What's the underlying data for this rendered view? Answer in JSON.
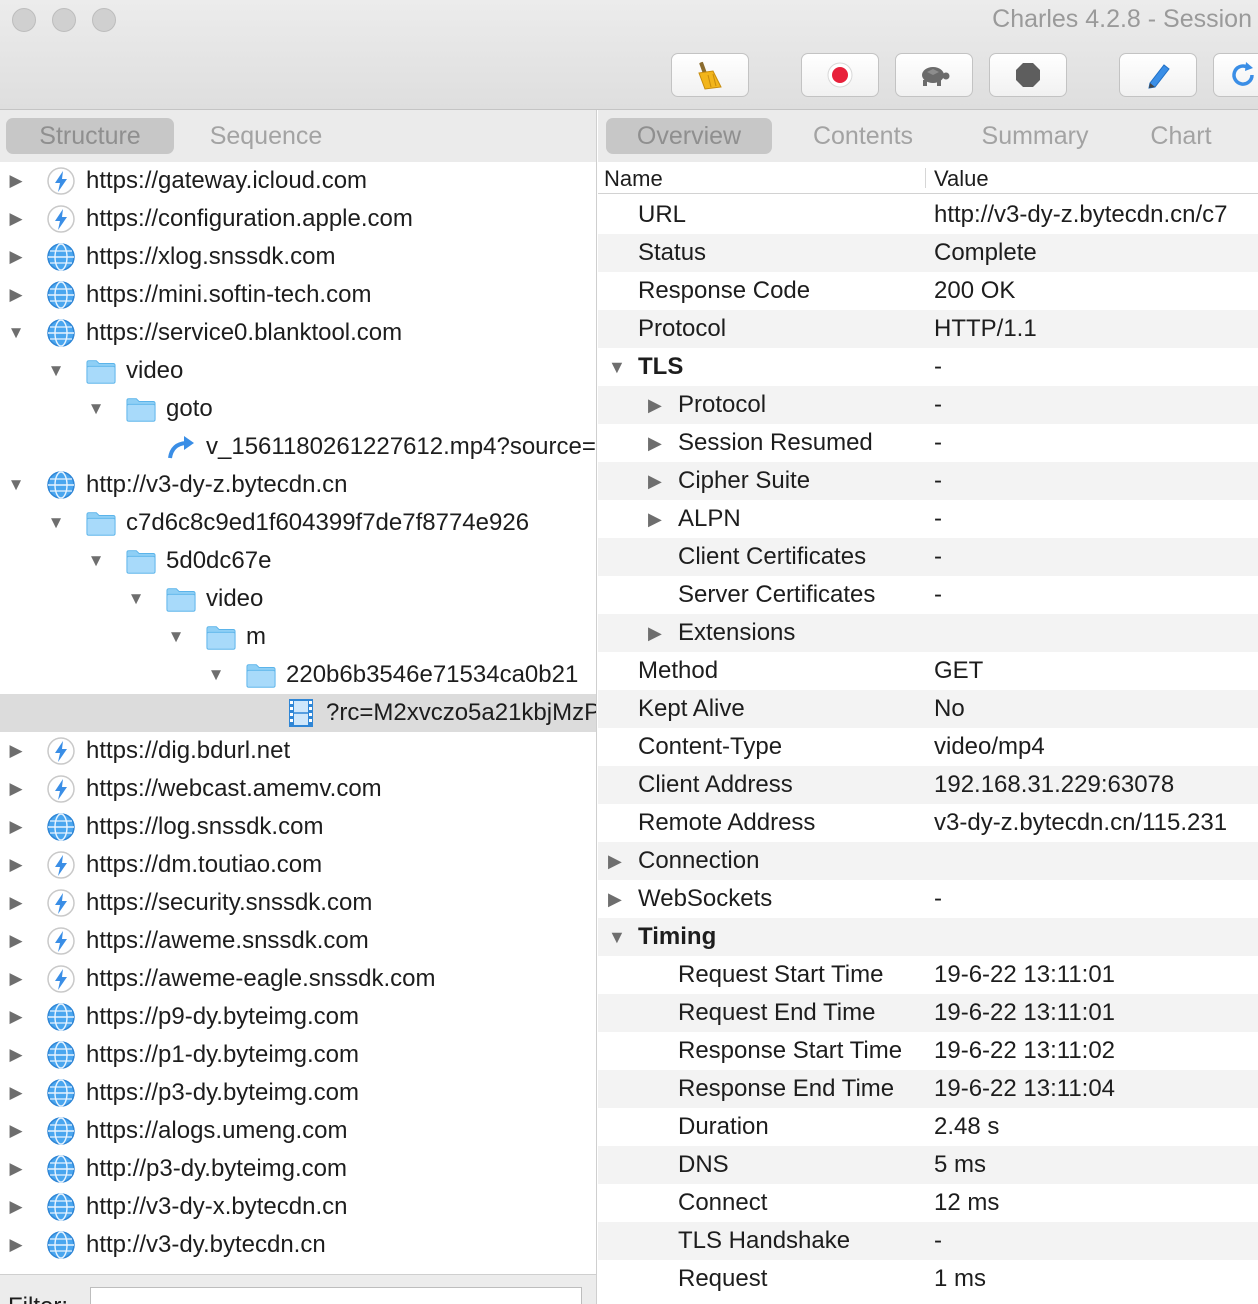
{
  "window": {
    "title": "Charles 4.2.8 - Session"
  },
  "toolbar": {
    "buttons": [
      {
        "name": "broom-icon"
      },
      {
        "name": "record-icon"
      },
      {
        "name": "turtle-icon"
      },
      {
        "name": "stop-icon"
      },
      {
        "name": "pen-icon"
      },
      {
        "name": "refresh-icon"
      }
    ]
  },
  "left": {
    "tabs": [
      {
        "label": "Structure",
        "active": true
      },
      {
        "label": "Sequence",
        "active": false
      }
    ],
    "tree": [
      {
        "label": "https://gateway.icloud.com",
        "icon": "bolt-icon",
        "expanded": false
      },
      {
        "label": "https://configuration.apple.com",
        "icon": "bolt-icon",
        "expanded": false
      },
      {
        "label": "https://xlog.snssdk.com",
        "icon": "globe-icon",
        "expanded": false
      },
      {
        "label": "https://mini.softin-tech.com",
        "icon": "globe-icon",
        "expanded": false
      },
      {
        "label": "https://service0.blanktool.com",
        "icon": "globe-icon",
        "expanded": true
      },
      {
        "label": "video",
        "icon": "folder-icon",
        "expanded": true
      },
      {
        "label": "goto",
        "icon": "folder-icon",
        "expanded": true
      },
      {
        "label": "v_1561180261227612.mp4?source=",
        "icon": "redirect-icon",
        "expanded": null
      },
      {
        "label": "http://v3-dy-z.bytecdn.cn",
        "icon": "globe-icon",
        "expanded": true
      },
      {
        "label": "c7d6c8c9ed1f604399f7de7f8774e926",
        "icon": "folder-icon",
        "expanded": true
      },
      {
        "label": "5d0dc67e",
        "icon": "folder-icon",
        "expanded": true
      },
      {
        "label": "video",
        "icon": "folder-icon",
        "expanded": true
      },
      {
        "label": "m",
        "icon": "folder-icon",
        "expanded": true
      },
      {
        "label": "220b6b3546e71534ca0b21",
        "icon": "folder-icon",
        "expanded": true
      },
      {
        "label": "?rc=M2xvczo5a21kbjMzP",
        "icon": "film-icon",
        "expanded": null,
        "selected": true
      },
      {
        "label": "https://dig.bdurl.net",
        "icon": "bolt-icon",
        "expanded": false
      },
      {
        "label": "https://webcast.amemv.com",
        "icon": "bolt-icon",
        "expanded": false
      },
      {
        "label": "https://log.snssdk.com",
        "icon": "globe-icon",
        "expanded": false
      },
      {
        "label": "https://dm.toutiao.com",
        "icon": "bolt-icon",
        "expanded": false
      },
      {
        "label": "https://security.snssdk.com",
        "icon": "bolt-icon",
        "expanded": false
      },
      {
        "label": "https://aweme.snssdk.com",
        "icon": "bolt-icon",
        "expanded": false
      },
      {
        "label": "https://aweme-eagle.snssdk.com",
        "icon": "bolt-icon",
        "expanded": false
      },
      {
        "label": "https://p9-dy.byteimg.com",
        "icon": "globe-icon",
        "expanded": false
      },
      {
        "label": "https://p1-dy.byteimg.com",
        "icon": "globe-icon",
        "expanded": false
      },
      {
        "label": "https://p3-dy.byteimg.com",
        "icon": "globe-icon",
        "expanded": false
      },
      {
        "label": "https://alogs.umeng.com",
        "icon": "globe-icon",
        "expanded": false
      },
      {
        "label": "http://p3-dy.byteimg.com",
        "icon": "globe-icon",
        "expanded": false
      },
      {
        "label": "http://v3-dy-x.bytecdn.cn",
        "icon": "globe-icon",
        "expanded": false
      },
      {
        "label": "http://v3-dy.bytecdn.cn",
        "icon": "globe-icon",
        "expanded": false
      }
    ],
    "filter_label": "Filter:"
  },
  "right": {
    "tabs": [
      {
        "label": "Overview",
        "active": true
      },
      {
        "label": "Contents",
        "active": false
      },
      {
        "label": "Summary",
        "active": false
      },
      {
        "label": "Chart",
        "active": false
      }
    ],
    "columns": {
      "name": "Name",
      "value": "Value"
    },
    "rows": [
      {
        "name": "URL",
        "value": "http://v3-dy-z.bytecdn.cn/c7",
        "level": 1,
        "toggle": null
      },
      {
        "name": "Status",
        "value": "Complete",
        "level": 1,
        "toggle": null
      },
      {
        "name": "Response Code",
        "value": "200 OK",
        "level": 1,
        "toggle": null
      },
      {
        "name": "Protocol",
        "value": "HTTP/1.1",
        "level": 1,
        "toggle": null
      },
      {
        "name": "TLS",
        "value": "-",
        "level": 0,
        "toggle": "open",
        "bold": true
      },
      {
        "name": "Protocol",
        "value": "-",
        "level": 2,
        "toggle": "closed"
      },
      {
        "name": "Session Resumed",
        "value": "-",
        "level": 2,
        "toggle": "closed"
      },
      {
        "name": "Cipher Suite",
        "value": "-",
        "level": 2,
        "toggle": "closed"
      },
      {
        "name": "ALPN",
        "value": "-",
        "level": 2,
        "toggle": "closed"
      },
      {
        "name": "Client Certificates",
        "value": "-",
        "level": 2,
        "toggle": null
      },
      {
        "name": "Server Certificates",
        "value": "-",
        "level": 2,
        "toggle": null
      },
      {
        "name": "Extensions",
        "value": "",
        "level": 2,
        "toggle": "closed"
      },
      {
        "name": "Method",
        "value": "GET",
        "level": 1,
        "toggle": null
      },
      {
        "name": "Kept Alive",
        "value": "No",
        "level": 1,
        "toggle": null
      },
      {
        "name": "Content-Type",
        "value": "video/mp4",
        "level": 1,
        "toggle": null
      },
      {
        "name": "Client Address",
        "value": "192.168.31.229:63078",
        "level": 1,
        "toggle": null
      },
      {
        "name": "Remote Address",
        "value": "v3-dy-z.bytecdn.cn/115.231",
        "level": 1,
        "toggle": null
      },
      {
        "name": "Connection",
        "value": "",
        "level": 0,
        "toggle": "closed"
      },
      {
        "name": "WebSockets",
        "value": "-",
        "level": 0,
        "toggle": "closed"
      },
      {
        "name": "Timing",
        "value": "",
        "level": 0,
        "toggle": "open",
        "bold": true
      },
      {
        "name": "Request Start Time",
        "value": "19-6-22 13:11:01",
        "level": 2,
        "toggle": null
      },
      {
        "name": "Request End Time",
        "value": "19-6-22 13:11:01",
        "level": 2,
        "toggle": null
      },
      {
        "name": "Response Start Time",
        "value": "19-6-22 13:11:02",
        "level": 2,
        "toggle": null
      },
      {
        "name": "Response End Time",
        "value": "19-6-22 13:11:04",
        "level": 2,
        "toggle": null
      },
      {
        "name": "Duration",
        "value": "2.48 s",
        "level": 2,
        "toggle": null
      },
      {
        "name": "DNS",
        "value": "5 ms",
        "level": 2,
        "toggle": null
      },
      {
        "name": "Connect",
        "value": "12 ms",
        "level": 2,
        "toggle": null
      },
      {
        "name": "TLS Handshake",
        "value": "-",
        "level": 2,
        "toggle": null
      },
      {
        "name": "Request",
        "value": "1 ms",
        "level": 2,
        "toggle": null
      }
    ]
  },
  "colors": {
    "accent_blue": "#3a8ee6",
    "record_red": "#e8203a",
    "folder_blue": "#8fcff5",
    "selection": "#dcdcdc"
  }
}
